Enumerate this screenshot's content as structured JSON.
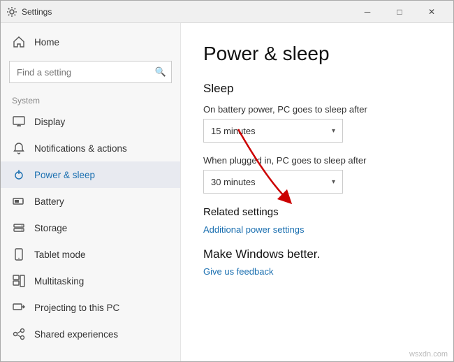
{
  "window": {
    "title": "Settings"
  },
  "titlebar": {
    "minimize": "─",
    "maximize": "□",
    "close": "✕"
  },
  "sidebar": {
    "search_placeholder": "Find a setting",
    "section_label": "System",
    "items": [
      {
        "id": "home",
        "label": "Home",
        "icon": "home"
      },
      {
        "id": "display",
        "label": "Display",
        "icon": "display"
      },
      {
        "id": "notifications",
        "label": "Notifications & actions",
        "icon": "notifications"
      },
      {
        "id": "power",
        "label": "Power & sleep",
        "icon": "power",
        "active": true
      },
      {
        "id": "battery",
        "label": "Battery",
        "icon": "battery"
      },
      {
        "id": "storage",
        "label": "Storage",
        "icon": "storage"
      },
      {
        "id": "tablet",
        "label": "Tablet mode",
        "icon": "tablet"
      },
      {
        "id": "multitasking",
        "label": "Multitasking",
        "icon": "multitasking"
      },
      {
        "id": "projecting",
        "label": "Projecting to this PC",
        "icon": "projecting"
      },
      {
        "id": "shared",
        "label": "Shared experiences",
        "icon": "shared"
      }
    ]
  },
  "main": {
    "page_title": "Power & sleep",
    "sleep_section": "Sleep",
    "battery_label": "On battery power, PC goes to sleep after",
    "battery_value": "15 minutes",
    "plugged_label": "When plugged in, PC goes to sleep after",
    "plugged_value": "30 minutes",
    "related_title": "Related settings",
    "related_link": "Additional power settings",
    "make_better_title": "Make Windows better.",
    "feedback_link": "Give us feedback"
  },
  "watermark": "wsxdn.com"
}
